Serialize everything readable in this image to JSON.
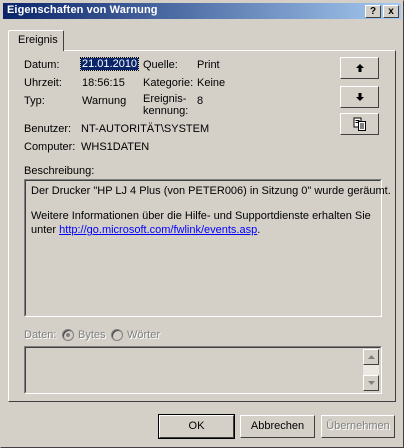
{
  "window": {
    "title": "Eigenschaften von Warnung",
    "help_btn": "?",
    "close_btn": "x"
  },
  "tabs": [
    {
      "label": "Ereignis"
    }
  ],
  "event": {
    "date_label": "Datum:",
    "date_value": "21.01.2010",
    "time_label": "Uhrzeit:",
    "time_value": "18:56:15",
    "type_label": "Typ:",
    "type_value": "Warnung",
    "user_label": "Benutzer:",
    "user_value": "NT-AUTORITÄT\\SYSTEM",
    "computer_label": "Computer:",
    "computer_value": "WHS1DATEN",
    "source_label": "Quelle:",
    "source_value": "Print",
    "category_label": "Kategorie:",
    "category_value": "Keine",
    "event_id_label_1": "Ereignis-",
    "event_id_label_2": "kennung:",
    "event_id_value": "8"
  },
  "side_buttons": {
    "up": "arrow-up-icon",
    "down": "arrow-down-icon",
    "copy": "copy-icon"
  },
  "description": {
    "label": "Beschreibung:",
    "line1": "Der Drucker \"HP LJ 4 Plus (von PETER006) in Sitzung 0\" wurde geräumt.",
    "line2": "Weitere Informationen über die Hilfe- und Supportdienste erhalten Sie",
    "line3_prefix": "unter ",
    "link": "http://go.microsoft.com/fwlink/events.asp",
    "line3_suffix": "."
  },
  "data_section": {
    "label": "Daten:",
    "opt_bytes": "Bytes",
    "opt_words": "Wörter"
  },
  "buttons": {
    "ok": "OK",
    "cancel": "Abbrechen",
    "apply": "Übernehmen"
  }
}
